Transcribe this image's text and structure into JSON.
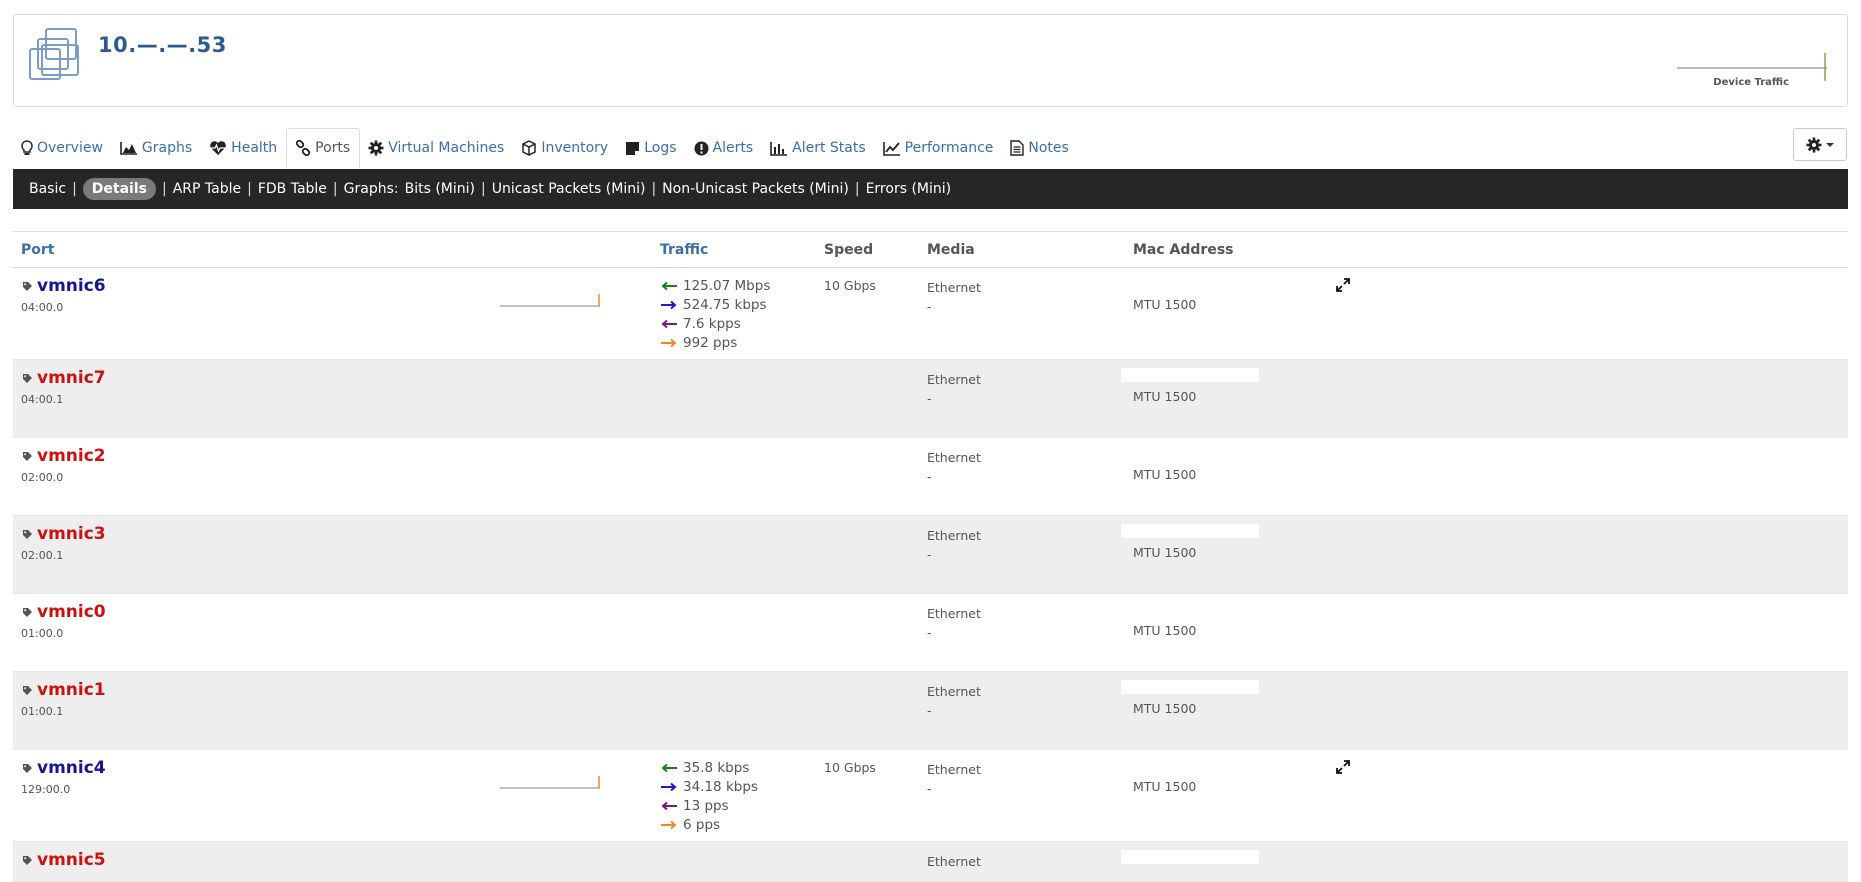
{
  "device": {
    "title": "10.—.—.53",
    "traffic_label": "Device Traffic"
  },
  "tabs": [
    {
      "label": "Overview",
      "icon": "lightbulb-icon"
    },
    {
      "label": "Graphs",
      "icon": "area-chart-icon"
    },
    {
      "label": "Health",
      "icon": "heartbeat-icon"
    },
    {
      "label": "Ports",
      "icon": "link-icon",
      "active": true
    },
    {
      "label": "Virtual Machines",
      "icon": "gear-icon"
    },
    {
      "label": "Inventory",
      "icon": "cube-icon"
    },
    {
      "label": "Logs",
      "icon": "sticky-note-icon"
    },
    {
      "label": "Alerts",
      "icon": "exclamation-circle-icon"
    },
    {
      "label": "Alert Stats",
      "icon": "bar-chart-icon"
    },
    {
      "label": "Performance",
      "icon": "line-chart-icon"
    },
    {
      "label": "Notes",
      "icon": "file-text-icon"
    }
  ],
  "subnav": {
    "basic": "Basic",
    "details": "Details",
    "arp": "ARP Table",
    "fdb": "FDB Table",
    "graphs_prefix": "Graphs:",
    "bits": "Bits (Mini)",
    "unicast": "Unicast Packets (Mini)",
    "nonunicast": "Non-Unicast Packets (Mini)",
    "errors": "Errors (Mini)",
    "sep": "|"
  },
  "table": {
    "headers": {
      "port": "Port",
      "traffic": "Traffic",
      "speed": "Speed",
      "media": "Media",
      "mac": "Mac Address"
    },
    "rows": [
      {
        "name": "vmnic6",
        "sub": "04:00.0",
        "status": "up",
        "speed": "10 Gbps",
        "media": "Ethernet",
        "media2": "-",
        "mtu": "MTU 1500",
        "traffic": [
          "125.07 Mbps",
          "524.75 kbps",
          "7.6 kpps",
          "992 pps"
        ]
      },
      {
        "name": "vmnic7",
        "sub": "04:00.1",
        "status": "down",
        "speed": "",
        "media": "Ethernet",
        "media2": "-",
        "mtu": "MTU 1500",
        "traffic": []
      },
      {
        "name": "vmnic2",
        "sub": "02:00.0",
        "status": "down",
        "speed": "",
        "media": "Ethernet",
        "media2": "-",
        "mtu": "MTU 1500",
        "traffic": []
      },
      {
        "name": "vmnic3",
        "sub": "02:00.1",
        "status": "down",
        "speed": "",
        "media": "Ethernet",
        "media2": "-",
        "mtu": "MTU 1500",
        "traffic": []
      },
      {
        "name": "vmnic0",
        "sub": "01:00.0",
        "status": "down",
        "speed": "",
        "media": "Ethernet",
        "media2": "-",
        "mtu": "MTU 1500",
        "traffic": []
      },
      {
        "name": "vmnic1",
        "sub": "01:00.1",
        "status": "down",
        "speed": "",
        "media": "Ethernet",
        "media2": "-",
        "mtu": "MTU 1500",
        "traffic": []
      },
      {
        "name": "vmnic4",
        "sub": "129:00.0",
        "status": "up",
        "speed": "10 Gbps",
        "media": "Ethernet",
        "media2": "-",
        "mtu": "MTU 1500",
        "traffic": [
          "35.8 kbps",
          "34.18 kbps",
          "13 pps",
          "6 pps"
        ]
      },
      {
        "name": "vmnic5",
        "sub": "",
        "status": "down",
        "speed": "",
        "media": "Ethernet",
        "media2": "",
        "mtu": "",
        "traffic": []
      }
    ]
  },
  "colors": {
    "in_bits": "#1a7f1a",
    "out_bits": "#1a1ad0",
    "in_pkts": "#7a1a7a",
    "out_pkts": "#f08a1a",
    "port_up": "#161690",
    "port_down": "#cc1111",
    "link": "#3b6fa5"
  }
}
